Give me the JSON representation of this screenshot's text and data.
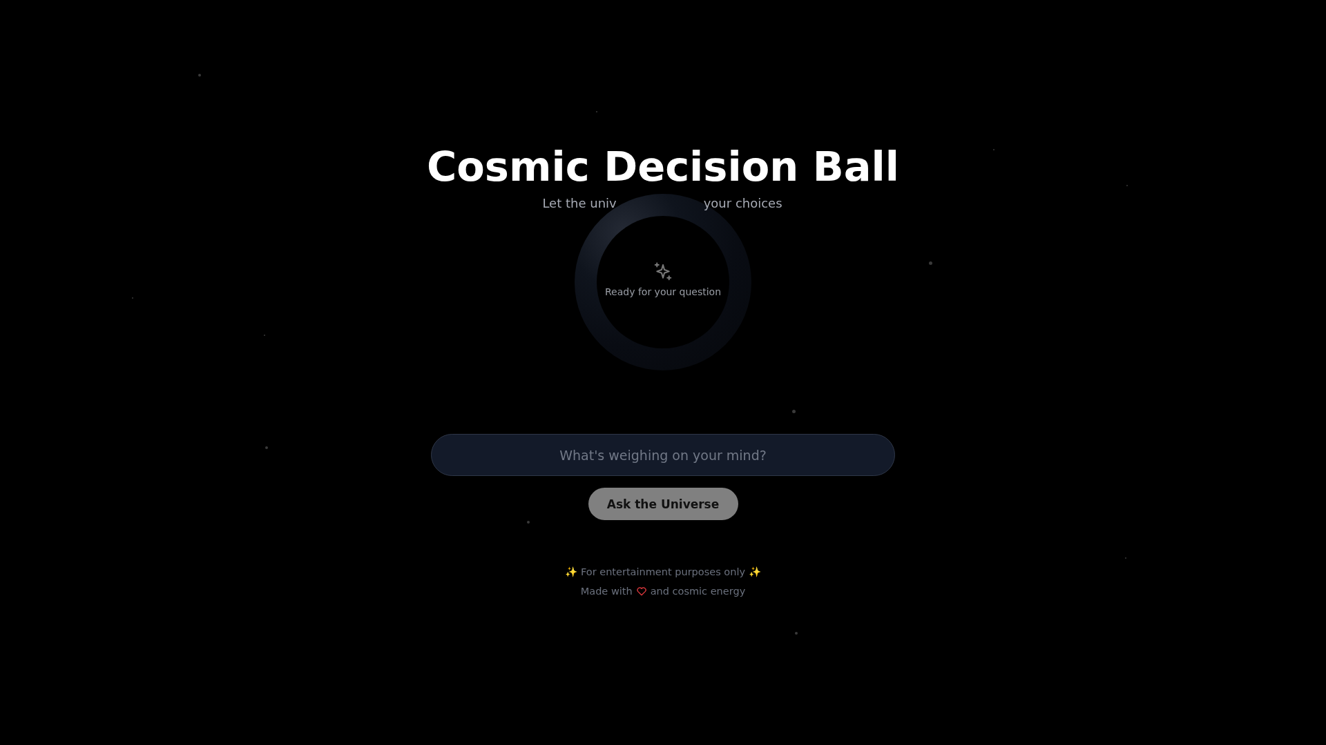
{
  "title": "Cosmic Decision Ball",
  "subtitle": {
    "parts": [
      "Let the univ",
      "your choices"
    ]
  },
  "ball": {
    "status": "Ready for your question"
  },
  "question_field": {
    "placeholder": "What's weighing on your mind?"
  },
  "ask_button": {
    "label": "Ask the Universe"
  },
  "footer": {
    "disclaimer": "✨ For entertainment purposes only ✨",
    "credit_before": "Made with",
    "credit_after": "and cosmic energy"
  }
}
